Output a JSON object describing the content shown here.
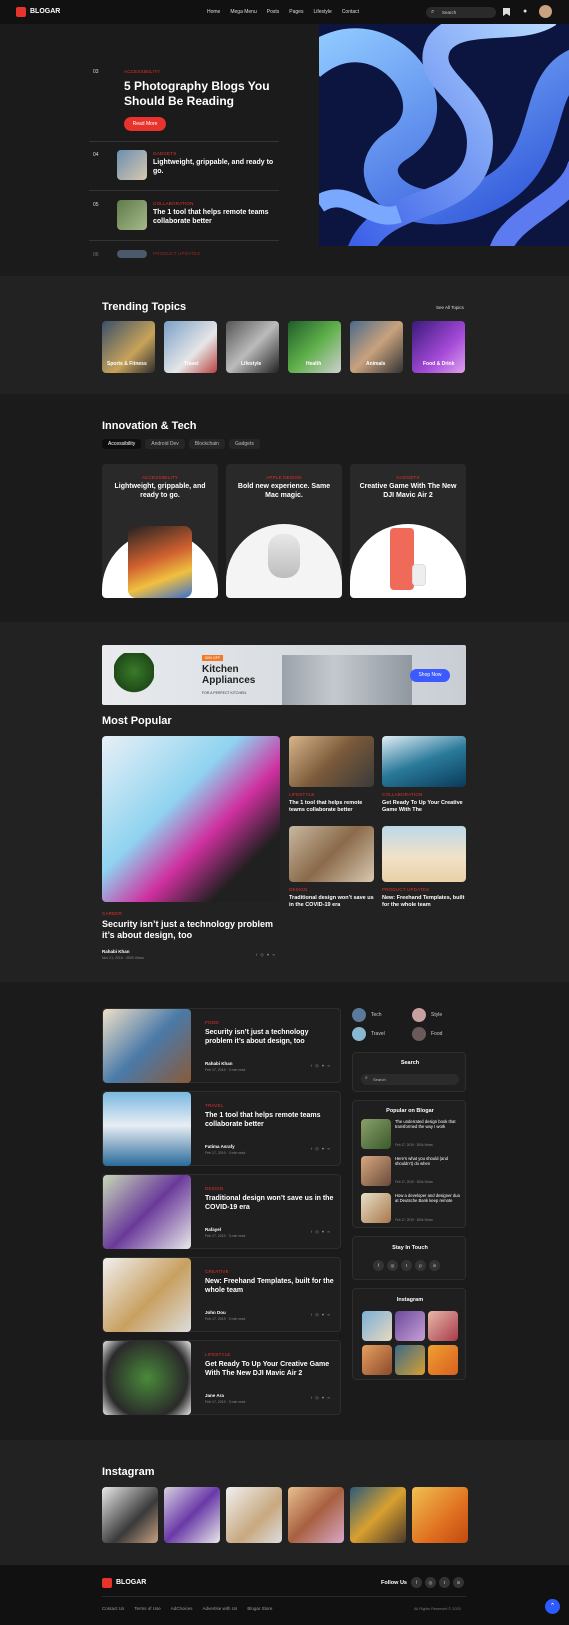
{
  "header": {
    "brand": "BLOGAR",
    "nav": [
      "Home",
      "Mega Menu",
      "Posts",
      "Pages",
      "Lifestyle",
      "Contact"
    ],
    "search_placeholder": "Search"
  },
  "hero": {
    "featured": {
      "num": "03",
      "category": "ACCESSIBILITY",
      "title": "5 Photography Blogs You Should Be Reading",
      "button": "Read More"
    },
    "list": [
      {
        "num": "04",
        "category": "GADGETS",
        "title": "Lightweight, grippable, and ready to go."
      },
      {
        "num": "05",
        "category": "COLLABORATION",
        "title": "The 1 tool that helps remote teams collaborate better"
      },
      {
        "num": "06",
        "category": "PRODUCT UPDATES",
        "title": ""
      }
    ]
  },
  "trending": {
    "title": "Trending Topics",
    "see_all": "See All Topics",
    "topics": [
      "Sports & Fitness",
      "Travel",
      "Lifestyle",
      "Health",
      "Animals",
      "Food & Drink"
    ]
  },
  "innovation": {
    "title": "Innovation & Tech",
    "tabs": [
      "Accessibility",
      "Android Dev",
      "Blockchain",
      "Gadgets"
    ],
    "cards": [
      {
        "category": "ACCESSIBILITY",
        "title": "Lightweight, grippable, and ready to go."
      },
      {
        "category": "APPLE DESIGN",
        "title": "Bold new experience. Same Mac magic."
      },
      {
        "category": "GADGETS",
        "title": "Creative Game With The New DJI Mavic Air 2"
      }
    ]
  },
  "banner": {
    "badge": "50% OFF",
    "title1": "Kitchen",
    "title2": "Appliances",
    "subtitle": "FOR A PERFECT KITCHEN.",
    "button": "Shop Now"
  },
  "most_popular": {
    "title": "Most Popular",
    "main": {
      "category": "CAREER",
      "title": "Security isn’t just a technology problem it’s about design, too",
      "author": "Rahabi Khan",
      "date": "Nov 21, 2016 · 3000 Views"
    },
    "grid": [
      {
        "category": "LIFESTYLE",
        "title": "The 1 tool that helps remote teams collaborate better"
      },
      {
        "category": "COLLABORATION",
        "title": "Get Ready To Up Your Creative Game With The"
      },
      {
        "category": "DESIGN",
        "title": "Traditional design won’t save us in the COVID-19 era"
      },
      {
        "category": "PRODUCT UPDATES",
        "title": "New: Freehand Templates, built for the whole team"
      }
    ]
  },
  "posts": [
    {
      "category": "FOOD",
      "title": "Security isn’t just a technology problem it’s about design, too",
      "author": "Rahabi Khan",
      "date": "Feb 17, 2019 · 3 min read"
    },
    {
      "category": "TRAVEL",
      "title": "The 1 tool that helps remote teams collaborate better",
      "author": "Fatima Asrafy",
      "date": "Feb 17, 2019 · 3 min read"
    },
    {
      "category": "DESIGN",
      "title": "Traditional design won’t save us in the COVID-19 era",
      "author": "Rafayel",
      "date": "Feb 17, 2019 · 3 min read"
    },
    {
      "category": "CREATIVE",
      "title": "New: Freehand Templates, built for the whole team",
      "author": "John Dou",
      "date": "Feb 17, 2019 · 3 min read"
    },
    {
      "category": "LIFESTYLE",
      "title": "Get Ready To Up Your Creative Game With The New DJI Mavic Air 2",
      "author": "Jane Ara",
      "date": "Feb 17, 2019 · 3 min read"
    }
  ],
  "sidebar": {
    "cats": [
      "Tech",
      "Style",
      "Travel",
      "Food"
    ],
    "search_title": "Search",
    "search_placeholder": "Search",
    "popular_title": "Popular on Blogar",
    "popular": [
      {
        "title": "The underrated design book that transformed the way I work",
        "date": "Feb 17, 2019 · 300k Views"
      },
      {
        "title": "Here’s what you should (and shouldn’t) do when",
        "date": "Feb 17, 2019 · 300k Views"
      },
      {
        "title": "How a developer and designer duo at Deutsche Bank keep remote",
        "date": "Feb 17, 2019 · 300k Views"
      }
    ],
    "touch_title": "Stay In Touch",
    "insta_title": "Instagram"
  },
  "instagram": {
    "title": "Instagram"
  },
  "footer": {
    "brand": "BLOGAR",
    "follow": "Follow Us",
    "links": [
      "Contact Us",
      "Terms of Use",
      "AdChoices",
      "Advertise with Us",
      "Blogar Store"
    ],
    "copyright": "All Rights Reserved © 2020"
  },
  "colors": {
    "accent": "#e8322c",
    "bg": "#1b1b1b",
    "alt": "#222222"
  }
}
